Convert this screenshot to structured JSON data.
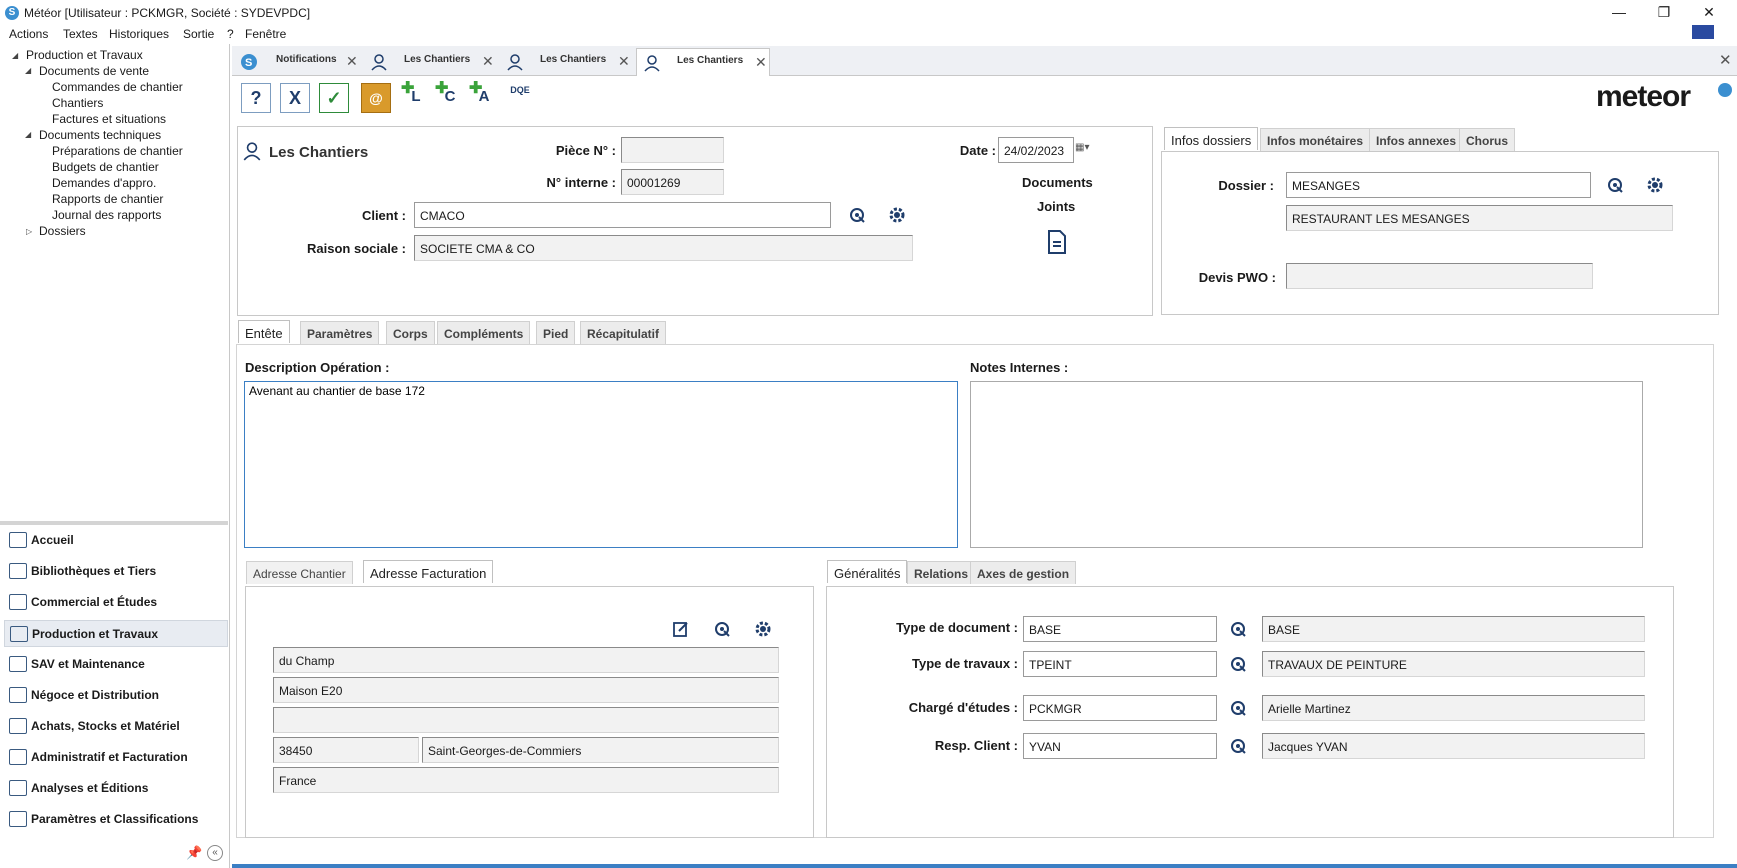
{
  "window": {
    "title": "Météor [Utilisateur : PCKMGR, Société : SYDEVPDC]",
    "controls": {
      "minimize": "—",
      "restore": "❐",
      "close": "✕"
    }
  },
  "menu": [
    "Actions",
    "Textes",
    "Historiques",
    "Sortie",
    "?",
    "Fenêtre"
  ],
  "tree": {
    "root": "Production et Travaux",
    "groups": [
      {
        "label": "Documents de vente",
        "items": [
          "Commandes de chantier",
          "Chantiers",
          "Factures et situations"
        ]
      },
      {
        "label": "Documents techniques",
        "items": [
          "Préparations de chantier",
          "Budgets de chantier",
          "Demandes d'appro.",
          "Rapports de chantier",
          "Journal des rapports"
        ]
      },
      {
        "label": "Dossiers",
        "items": []
      }
    ]
  },
  "nav": [
    "Accueil",
    "Bibliothèques et Tiers",
    "Commercial et Études",
    "Production et Travaux",
    "SAV et Maintenance",
    "Négoce et Distribution",
    "Achats, Stocks et Matériel",
    "Administratif et Facturation",
    "Analyses et Éditions",
    "Paramètres et Classifications"
  ],
  "doc_tabs": [
    "Notifications",
    "Les Chantiers",
    "Les Chantiers",
    "Les Chantiers"
  ],
  "toolbar": {
    "help": "?",
    "cancel": "X",
    "validate": "✓",
    "contacts": "@",
    "add_l": "L",
    "add_c": "C",
    "add_a": "A",
    "dqe": "DQE"
  },
  "brand": "meteor",
  "header": {
    "module_title": "Les Chantiers",
    "piece_label": "Pièce N° :",
    "piece_value": "",
    "interne_label": "N° interne :",
    "interne_value": "00001269",
    "client_label": "Client :",
    "client_value": "CMACO",
    "raison_label": "Raison sociale :",
    "raison_value": "SOCIETE CMA & CO",
    "date_label": "Date :",
    "date_value": "24/02/2023",
    "documents_label": "Documents",
    "joints_label": "Joints"
  },
  "dossier_tabs": [
    "Infos dossiers",
    "Infos monétaires",
    "Infos annexes",
    "Chorus"
  ],
  "dossier": {
    "dossier_label": "Dossier :",
    "dossier_value": "MESANGES",
    "dossier_desc": "RESTAURANT LES MESANGES",
    "devis_label": "Devis PWO :",
    "devis_value": ""
  },
  "main_tabs": [
    "Entête",
    "Paramètres",
    "Corps",
    "Compléments",
    "Pied",
    "Récapitulatif"
  ],
  "entete": {
    "desc_label": "Description Opération :",
    "desc_value": "Avenant au chantier de base 172",
    "notes_label": "Notes Internes :",
    "notes_value": ""
  },
  "address_tabs": [
    "Adresse Chantier",
    "Adresse Facturation"
  ],
  "address": {
    "line1": "du Champ",
    "line2": "Maison E20",
    "line3": "",
    "postcode": "38450",
    "city": "Saint-Georges-de-Commiers",
    "country": "France"
  },
  "gen_tabs": [
    "Généralités",
    "Relations",
    "Axes de gestion"
  ],
  "generalites": {
    "rows": [
      {
        "label": "Type de document :",
        "code": "BASE",
        "desc": "BASE"
      },
      {
        "label": "Type de travaux :",
        "code": "TPEINT",
        "desc": "TRAVAUX DE PEINTURE"
      },
      {
        "label": "Chargé d'études :",
        "code": "PCKMGR",
        "desc": "Arielle Martinez"
      },
      {
        "label": "Resp. Client :",
        "code": "YVAN",
        "desc": "Jacques YVAN"
      }
    ]
  }
}
